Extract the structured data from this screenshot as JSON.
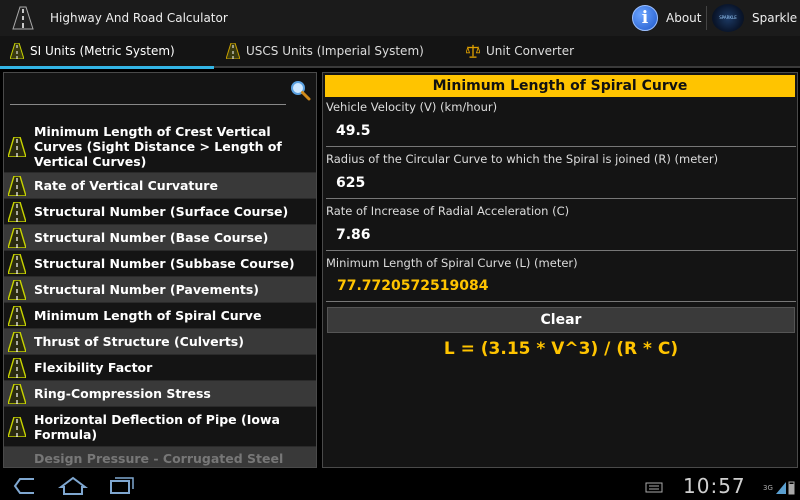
{
  "app": {
    "title": "Highway And Road Calculator"
  },
  "actions": {
    "about_label": "About",
    "sparkle_label": "Sparkle",
    "sparkle_logo_text": "SPARKLE"
  },
  "tabs": [
    {
      "label": "SI Units (Metric System)",
      "active": true
    },
    {
      "label": "USCS Units (Imperial System)",
      "active": false
    },
    {
      "label": "Unit Converter",
      "active": false
    }
  ],
  "search": {
    "value": "",
    "placeholder": ""
  },
  "list": [
    {
      "label": "Minimum Length of Crest Vertical Curves (Sight Distance > Length of Vertical Curves)"
    },
    {
      "label": "Rate of Vertical Curvature"
    },
    {
      "label": "Structural Number (Surface Course)"
    },
    {
      "label": "Structural Number (Base Course)"
    },
    {
      "label": "Structural Number (Subbase Course)"
    },
    {
      "label": "Structural Number (Pavements)"
    },
    {
      "label": "Minimum Length of Spiral Curve"
    },
    {
      "label": "Thrust of Structure (Culverts)"
    },
    {
      "label": "Flexibility Factor"
    },
    {
      "label": "Ring-Compression Stress"
    },
    {
      "label": "Horizontal Deflection of Pipe (Iowa Formula)"
    },
    {
      "label": "Design Pressure - Corrugated Steel"
    }
  ],
  "form": {
    "title": "Minimum Length of Spiral Curve",
    "fields": [
      {
        "label": "Vehicle Velocity (V) (km/hour)",
        "value": "49.5"
      },
      {
        "label": "Radius of the Circular Curve to which the Spiral is joined (R) (meter)",
        "value": "625"
      },
      {
        "label": "Rate of Increase of Radial Acceleration (C)",
        "value": "7.86"
      }
    ],
    "result_label": "Minimum Length of Spiral Curve (L) (meter)",
    "result_value": "77.7720572519084",
    "clear_label": "Clear",
    "formula": "L = (3.15 * V^3) / (R * C)"
  },
  "system": {
    "clock": "10:57",
    "network": "3G"
  },
  "colors": {
    "accent": "#ffc400",
    "tab_indicator": "#33b5e5",
    "list_alt": "#393939"
  },
  "icons": [
    "road-icon",
    "info-icon",
    "sparkle-logo",
    "scale-icon",
    "search-icon",
    "back-icon",
    "home-icon",
    "recent-apps-icon"
  ]
}
